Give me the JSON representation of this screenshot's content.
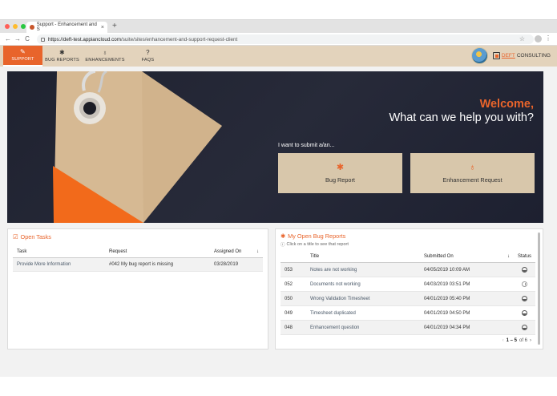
{
  "browser": {
    "tab_title": "Support - Enhancement and S",
    "tab_close": "×",
    "new_tab": "+",
    "url_host": "https://deft-test.appiancloud.com",
    "url_path": "/suite/sites/enhancement-and-support-request-client",
    "back": "←",
    "forward": "→",
    "reload": "C",
    "star": "☆",
    "menu": "⋮"
  },
  "nav": {
    "items": [
      {
        "label": "SUPPORT",
        "icon": "wrench-icon",
        "glyph": "🔧"
      },
      {
        "label": "BUG REPORTS",
        "icon": "bug-icon",
        "glyph": "✱"
      },
      {
        "label": "ENHANCEMENTS",
        "icon": "lightbulb-icon",
        "glyph": "💡"
      },
      {
        "label": "FAQS",
        "icon": "question-icon",
        "glyph": "?"
      }
    ]
  },
  "brand": {
    "prefix": "DEFT",
    "suffix": "CONSULTING"
  },
  "hero": {
    "welcome": "Welcome,",
    "headline": "What can we help you with?",
    "prompt": "I want to submit a/an...",
    "bug_button": "Bug Report",
    "enhancement_button": "Enhancement Request"
  },
  "open_tasks": {
    "title": "Open Tasks",
    "columns": [
      "Task",
      "Request",
      "Assigned On"
    ],
    "rows": [
      {
        "task": "Provide More Information",
        "request": "#042 My bug report is missing",
        "assigned_on": "03/28/2019"
      }
    ]
  },
  "bug_reports": {
    "title": "My Open Bug Reports",
    "subtitle": "Click on a title to see that report",
    "columns": [
      "Title",
      "Submitted On",
      "Status"
    ],
    "rows": [
      {
        "id": "053",
        "title": "Notes are not working",
        "submitted": "04/05/2019 10:09 AM",
        "status": "half"
      },
      {
        "id": "052",
        "title": "Documents not working",
        "submitted": "04/03/2019 03:51 PM",
        "status": "clock"
      },
      {
        "id": "050",
        "title": "Wrong Validation Timesheet",
        "submitted": "04/01/2019 05:40 PM",
        "status": "half"
      },
      {
        "id": "049",
        "title": "Timesheet duplicated",
        "submitted": "04/01/2019 04:50 PM",
        "status": "half"
      },
      {
        "id": "048",
        "title": "Enhancement question",
        "submitted": "04/01/2019 04:34 PM",
        "status": "half"
      }
    ],
    "pager_range": "1 – 5",
    "pager_of": "of 6"
  },
  "colors": {
    "accent": "#e8642b",
    "header": "#e3d3bc",
    "hero_bg": "#23263a",
    "button_bg": "#d8c7ab"
  }
}
